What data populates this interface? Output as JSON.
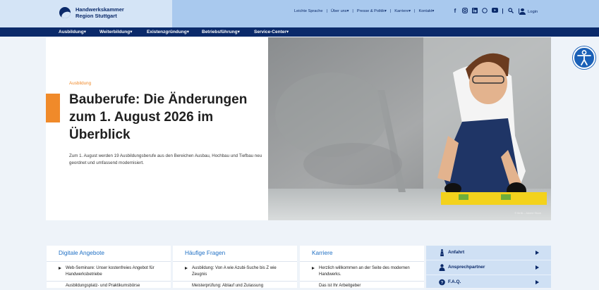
{
  "header": {
    "logo_line1": "Handwerkskammer",
    "logo_line2": "Region Stuttgart",
    "util_links": [
      "Leichte Sprache",
      "Über uns",
      "Presse & Politik",
      "Karriere",
      "Kontakt"
    ],
    "social_icons": [
      "facebook-icon",
      "instagram-icon",
      "linkedin-icon",
      "whatsapp-icon",
      "youtube-icon"
    ],
    "login_label": "Login"
  },
  "nav": {
    "items": [
      "Ausbildung",
      "Weiterbildung",
      "Existenzgründung",
      "Betriebsführung",
      "Service-Center"
    ]
  },
  "hero": {
    "kicker": "Ausbildung",
    "title": "Bauberufe: Die Änderungen zum 1. August 2026 im Überblick",
    "lead": "Zum 1. August werden 19 Ausbildungsberufe aus den Bereichen Ausbau, Hochbau und Tiefbau neu geordnet und umfassend modernisiert.",
    "image_credit": "© fertik – Adobe Stock"
  },
  "columns": [
    {
      "title": "Digitale Angebote",
      "entry": "Web-Seminare: Unser kostenfreies Angebot für Handwerksbetriebe",
      "entry2": "Ausbildungsplatz- und Praktikumsbörse"
    },
    {
      "title": "Häufige Fragen",
      "entry": "Ausbildung: Von A wie Azubi-Suche bis Z wie Zeugnis",
      "entry2": "Meisterprüfung: Ablauf und Zulassung"
    },
    {
      "title": "Karriere",
      "entry": "Herzlich willkommen an der Seite des modernen Handwerks.",
      "entry2": "Das ist Ihr Arbeitgeber"
    }
  ],
  "sidebar": {
    "items": [
      "Anfahrt",
      "Ansprechpartner",
      "F.A.Q."
    ]
  },
  "colors": {
    "navy": "#0b2a6a",
    "top_bar": "#a9c9ee",
    "accent_orange": "#f08a2a",
    "link_blue": "#1e6fc4"
  }
}
